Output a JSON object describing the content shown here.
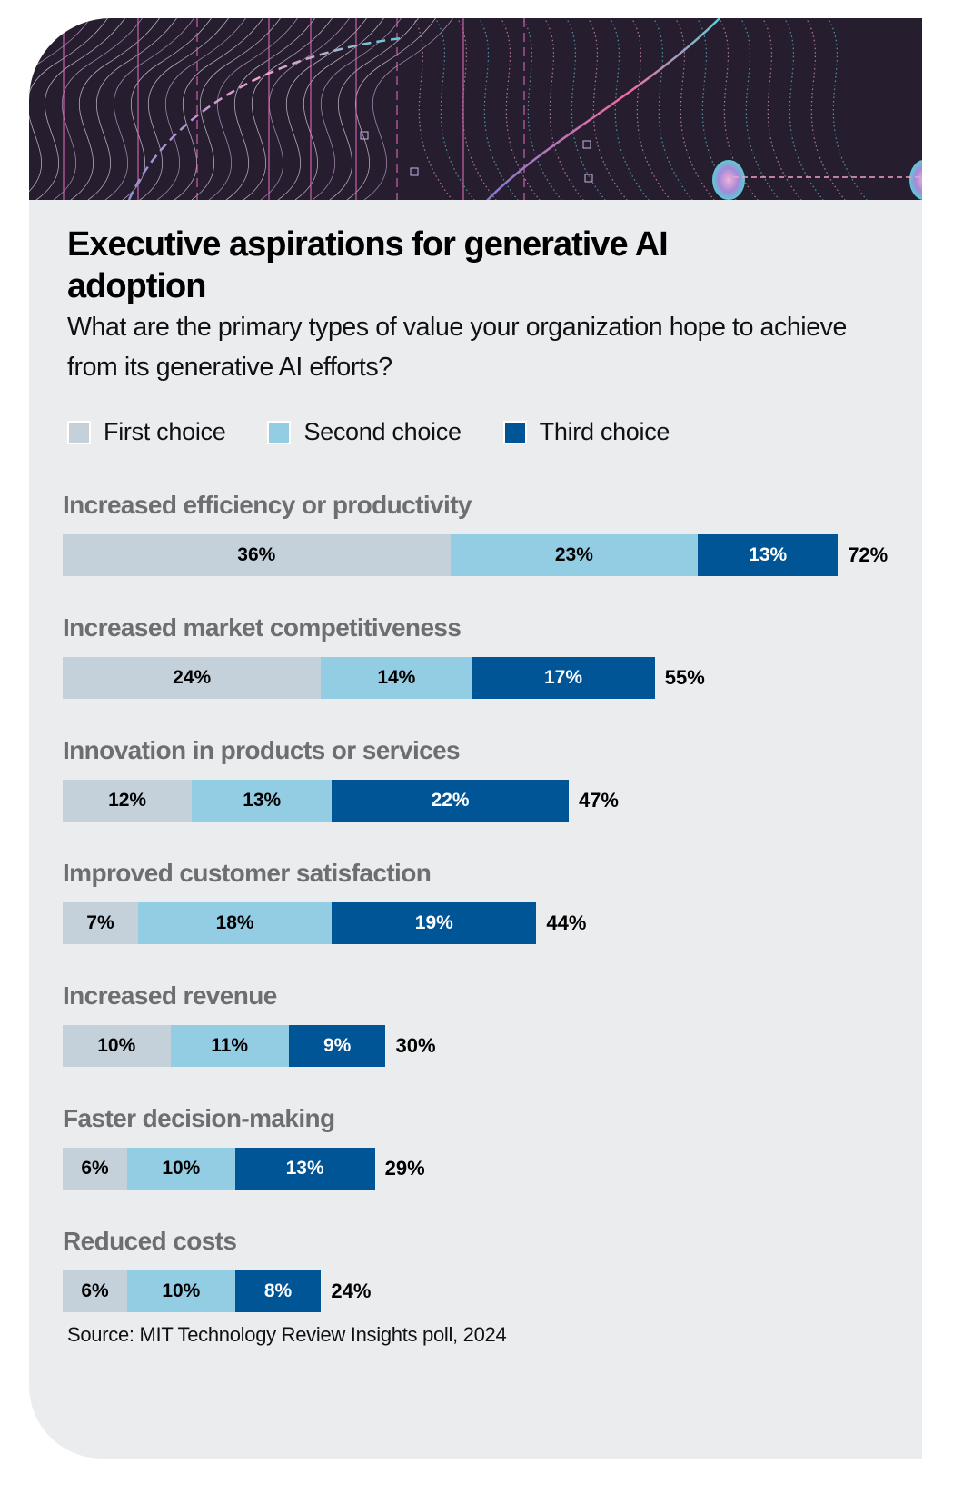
{
  "title": "Executive aspirations for generative AI adoption",
  "subtitle": "What are the primary types of value your organization hope to achieve from its generative AI efforts?",
  "source": "Source: MIT Technology Review Insights poll, 2024",
  "colors": {
    "first": "#c4d1da",
    "second": "#93cde3",
    "third": "#005596",
    "background": "#ebecee",
    "label": "#6d6e71",
    "hero": "#261e2e"
  },
  "legend": [
    {
      "name": "First choice",
      "color": "#c4d1da"
    },
    {
      "name": "Second choice",
      "color": "#93cde3"
    },
    {
      "name": "Third choice",
      "color": "#005596"
    }
  ],
  "chart_data": {
    "type": "bar",
    "orientation": "horizontal",
    "stacked": true,
    "title": "Executive aspirations for generative AI adoption",
    "subtitle": "What are the primary types of value your organization hope to achieve from its generative AI efforts?",
    "unit": "%",
    "xlim": [
      0,
      72
    ],
    "grid": false,
    "legend_position": "top-left",
    "categories": [
      "Increased efficiency or productivity",
      "Increased market competitiveness",
      "Innovation in products or services",
      "Improved customer satisfaction",
      "Increased revenue",
      "Faster decision-making",
      "Reduced costs"
    ],
    "series": [
      {
        "name": "First choice",
        "values": [
          36,
          24,
          12,
          7,
          10,
          6,
          6
        ]
      },
      {
        "name": "Second choice",
        "values": [
          23,
          14,
          13,
          18,
          11,
          10,
          10
        ]
      },
      {
        "name": "Third choice",
        "values": [
          13,
          17,
          22,
          19,
          9,
          13,
          8
        ]
      }
    ],
    "totals": [
      72,
      55,
      47,
      44,
      30,
      29,
      24
    ],
    "data_labels": [
      [
        "36%",
        "23%",
        "13%"
      ],
      [
        "24%",
        "14%",
        "17%"
      ],
      [
        "12%",
        "13%",
        "22%"
      ],
      [
        "7%",
        "18%",
        "19%"
      ],
      [
        "10%",
        "11%",
        "9%"
      ],
      [
        "6%",
        "10%",
        "13%"
      ],
      [
        "6%",
        "10%",
        "8%"
      ]
    ],
    "total_labels": [
      "72%",
      "55%",
      "47%",
      "44%",
      "30%",
      "29%",
      "24%"
    ],
    "source": "Source: MIT Technology Review Insights poll, 2024"
  }
}
